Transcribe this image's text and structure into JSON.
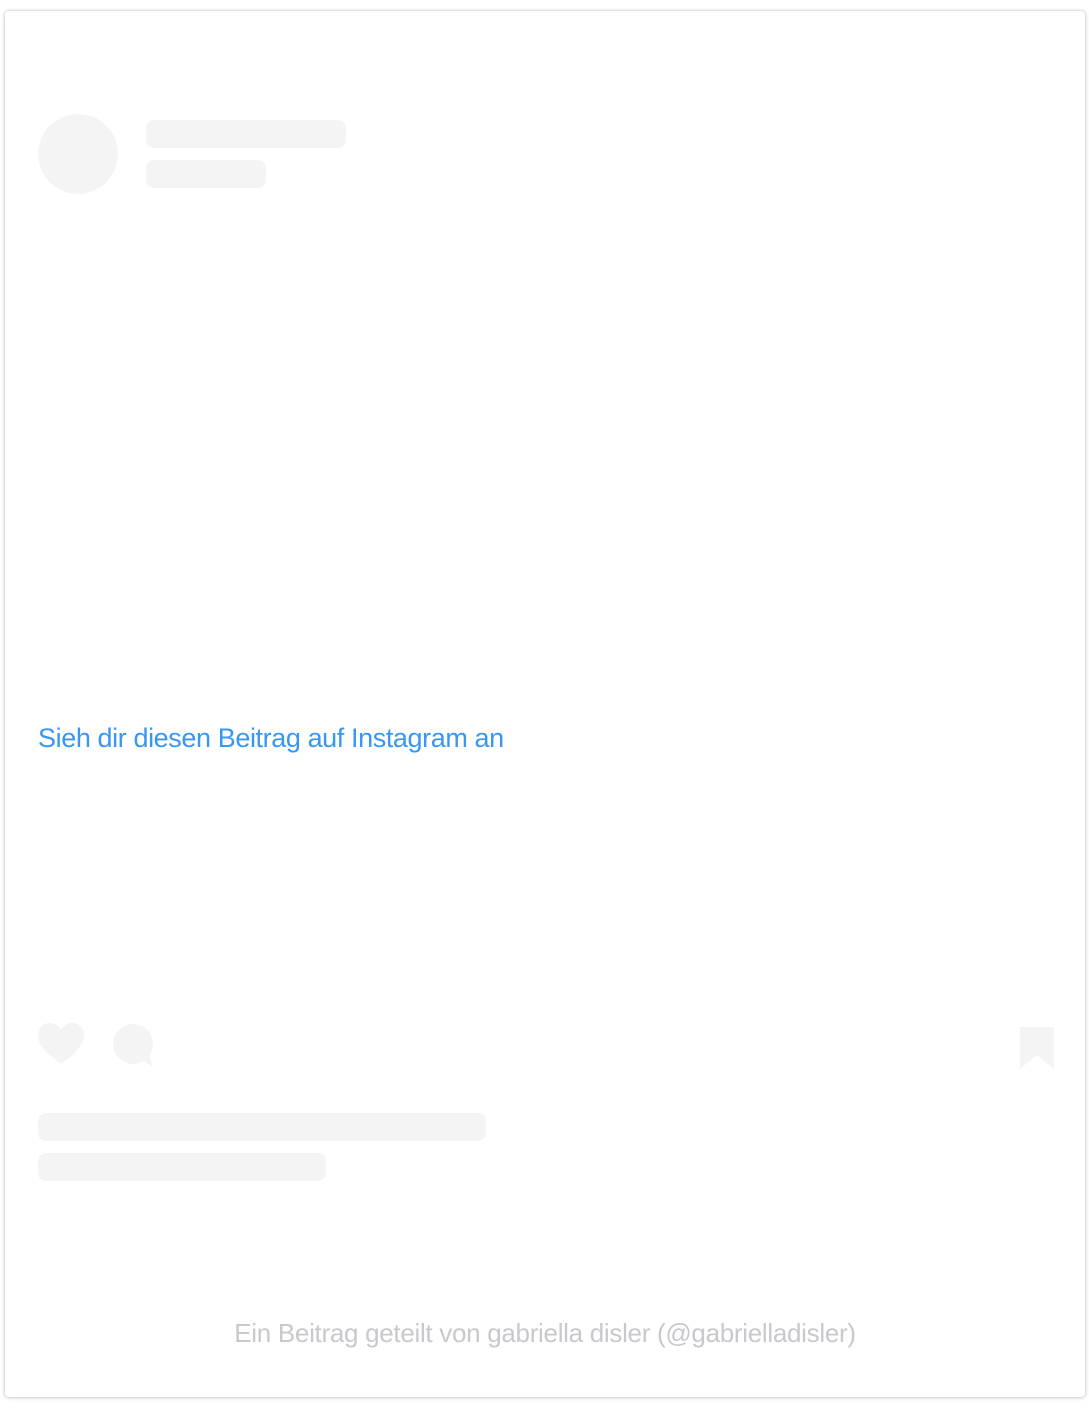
{
  "embed": {
    "view_link_text": "Sieh dir diesen Beitrag auf Instagram an",
    "footer_caption": "Ein Beitrag geteilt von gabriella disler (@gabrielladisler)",
    "icons": {
      "like": "heart-icon",
      "comment": "comment-icon",
      "save": "bookmark-icon"
    },
    "colors": {
      "link": "#3897f0",
      "placeholder": "#f4f4f4",
      "caption": "#c9c8cd"
    }
  }
}
